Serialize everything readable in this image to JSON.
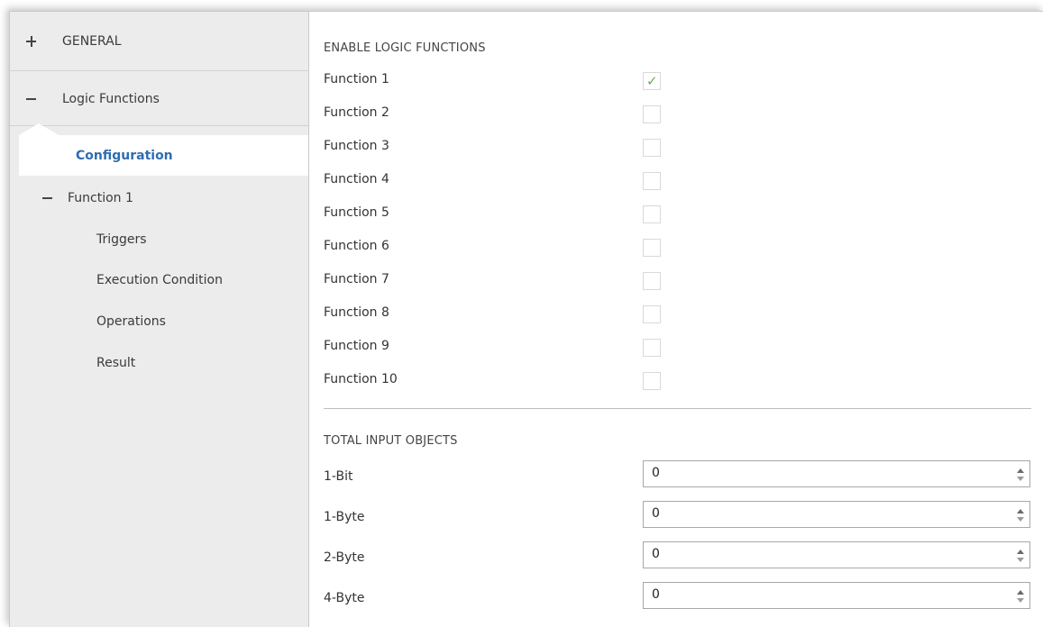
{
  "sidebar": {
    "general": {
      "label": "GENERAL",
      "expander": "plus-icon"
    },
    "logic_functions": {
      "label": "Logic Functions",
      "expander": "minus-icon"
    },
    "configuration": {
      "label": "Configuration"
    },
    "function1": {
      "label": "Function 1",
      "expander": "minus-icon"
    },
    "sub_items": [
      "Triggers",
      "Execution Condition",
      "Operations",
      "Result"
    ]
  },
  "enable": {
    "title": "ENABLE LOGIC FUNCTIONS",
    "check_glyph": "✓",
    "items": [
      {
        "label": "Function 1",
        "checked": true
      },
      {
        "label": "Function 2",
        "checked": false
      },
      {
        "label": "Function 3",
        "checked": false
      },
      {
        "label": "Function 4",
        "checked": false
      },
      {
        "label": "Function 5",
        "checked": false
      },
      {
        "label": "Function 6",
        "checked": false
      },
      {
        "label": "Function 7",
        "checked": false
      },
      {
        "label": "Function 8",
        "checked": false
      },
      {
        "label": "Function 9",
        "checked": false
      },
      {
        "label": "Function 10",
        "checked": false
      }
    ]
  },
  "total_inputs": {
    "title": "TOTAL INPUT OBJECTS",
    "items": [
      {
        "label": "1-Bit",
        "value": "0"
      },
      {
        "label": "1-Byte",
        "value": "0"
      },
      {
        "label": "2-Byte",
        "value": "0"
      },
      {
        "label": "4-Byte",
        "value": "0"
      }
    ]
  },
  "colors": {
    "accent": "#2f6db0",
    "check": "#6aaa5a",
    "sidebar_bg": "#ececec"
  }
}
